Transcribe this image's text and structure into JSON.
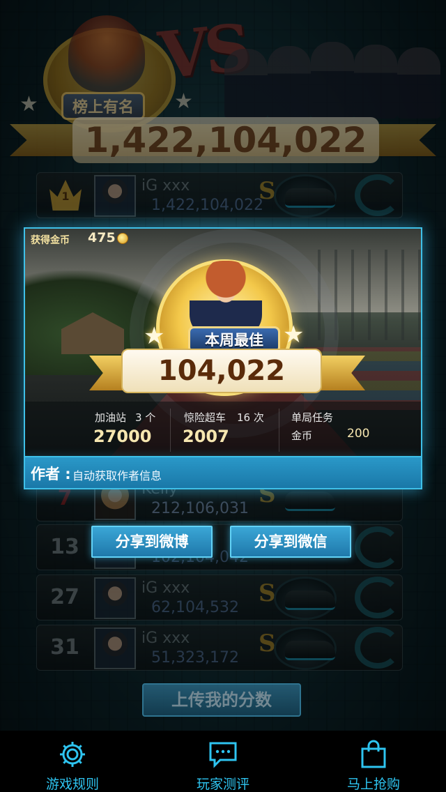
{
  "header": {
    "medal_label": "榜上有名",
    "vs_text": "VS",
    "top_score": "1,422,104,022"
  },
  "leaderboard": [
    {
      "rank": "1",
      "name": "iG xxx",
      "score": "1,422,104,022",
      "rank_style": "crown"
    },
    {
      "rank": "7",
      "name": "Kelly",
      "score": "212,106,031",
      "rank_style": "red"
    },
    {
      "rank": "13",
      "name": "",
      "score": "102,104,042",
      "rank_style": "gray"
    },
    {
      "rank": "27",
      "name": "iG xxx",
      "score": "62,104,532",
      "rank_style": "gray"
    },
    {
      "rank": "31",
      "name": "iG xxx",
      "score": "51,323,172",
      "rank_style": "gray"
    }
  ],
  "card": {
    "coins_label": "获得金币",
    "coins_value": "475",
    "medal_label": "本周最佳",
    "score": "104,022",
    "stats": {
      "station_label": "加油站",
      "station_count": "3 个",
      "station_value": "27000",
      "overtake_label": "惊险超车",
      "overtake_count": "16 次",
      "overtake_value": "2007",
      "mission_label": "单局任务",
      "mission_coin_label": "金币",
      "mission_coin_value": "200"
    },
    "author_label": "作者 :",
    "author_value": "自动获取作者信息"
  },
  "share": {
    "weibo": "分享到微博",
    "wechat": "分享到微信"
  },
  "upload_button": "上传我的分数",
  "bottom_nav": [
    {
      "label": "游戏规则",
      "icon": "gear-icon"
    },
    {
      "label": "玩家测评",
      "icon": "chat-bubble-icon"
    },
    {
      "label": "马上抢购",
      "icon": "shopping-bag-icon"
    }
  ],
  "colors": {
    "accent": "#2ec4f0",
    "gold": "#e9bf4d",
    "score_brown": "#5a2b0a",
    "score_blue": "#5d7aa5",
    "rank_red": "#a31c1c"
  }
}
